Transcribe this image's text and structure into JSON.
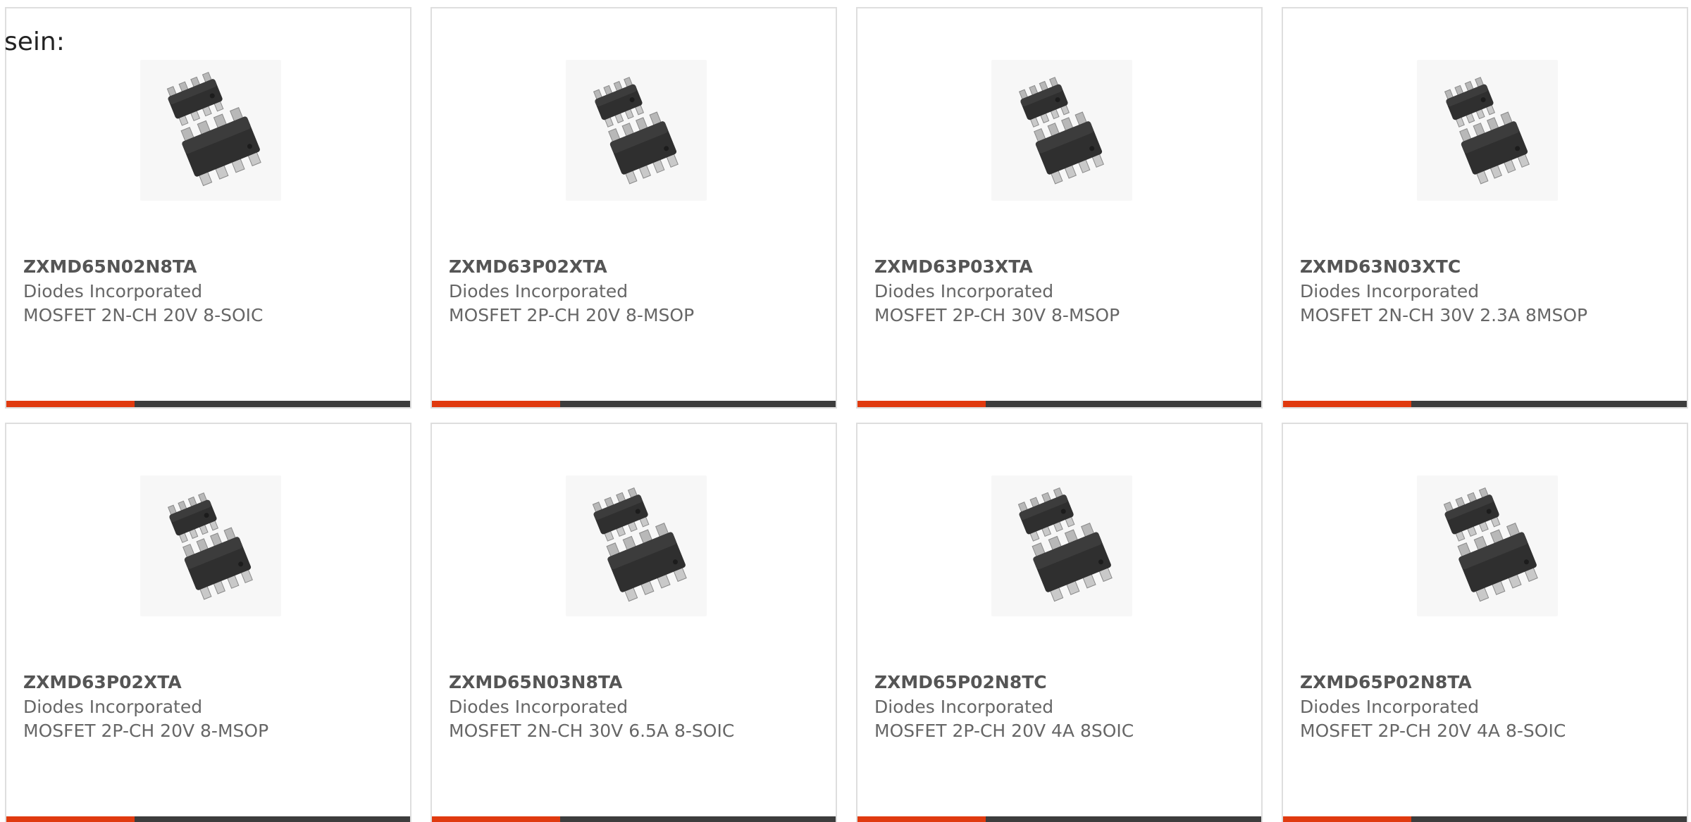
{
  "intro_text": "sein:",
  "colors": {
    "accent": "#e03a0f",
    "bar": "#3d3d3d",
    "border": "#dedede",
    "text": "#666666"
  },
  "products": [
    {
      "part": "ZXMD65N02N8TA",
      "manufacturer": "Diodes Incorporated",
      "description": "MOSFET 2N-CH 20V 8-SOIC",
      "package_icon": "soic-8-chip-icon"
    },
    {
      "part": "ZXMD63P02XTA",
      "manufacturer": "Diodes Incorporated",
      "description": "MOSFET 2P-CH 20V 8-MSOP",
      "package_icon": "msop-8-chip-icon"
    },
    {
      "part": "ZXMD63P03XTA",
      "manufacturer": "Diodes Incorporated",
      "description": "MOSFET 2P-CH 30V 8-MSOP",
      "package_icon": "msop-8-chip-icon"
    },
    {
      "part": "ZXMD63N03XTC",
      "manufacturer": "Diodes Incorporated",
      "description": "MOSFET 2N-CH 30V 2.3A 8MSOP",
      "package_icon": "msop-8-chip-icon"
    },
    {
      "part": "ZXMD63P02XTA",
      "manufacturer": "Diodes Incorporated",
      "description": "MOSFET 2P-CH 20V 8-MSOP",
      "package_icon": "msop-8-chip-icon"
    },
    {
      "part": "ZXMD65N03N8TA",
      "manufacturer": "Diodes Incorporated",
      "description": "MOSFET 2N-CH 30V 6.5A 8-SOIC",
      "package_icon": "soic-8-chip-icon"
    },
    {
      "part": "ZXMD65P02N8TC",
      "manufacturer": "Diodes Incorporated",
      "description": "MOSFET 2P-CH 20V 4A 8SOIC",
      "package_icon": "soic-8-chip-icon"
    },
    {
      "part": "ZXMD65P02N8TA",
      "manufacturer": "Diodes Incorporated",
      "description": "MOSFET 2P-CH 20V 4A 8-SOIC",
      "package_icon": "soic-8-chip-icon"
    }
  ]
}
